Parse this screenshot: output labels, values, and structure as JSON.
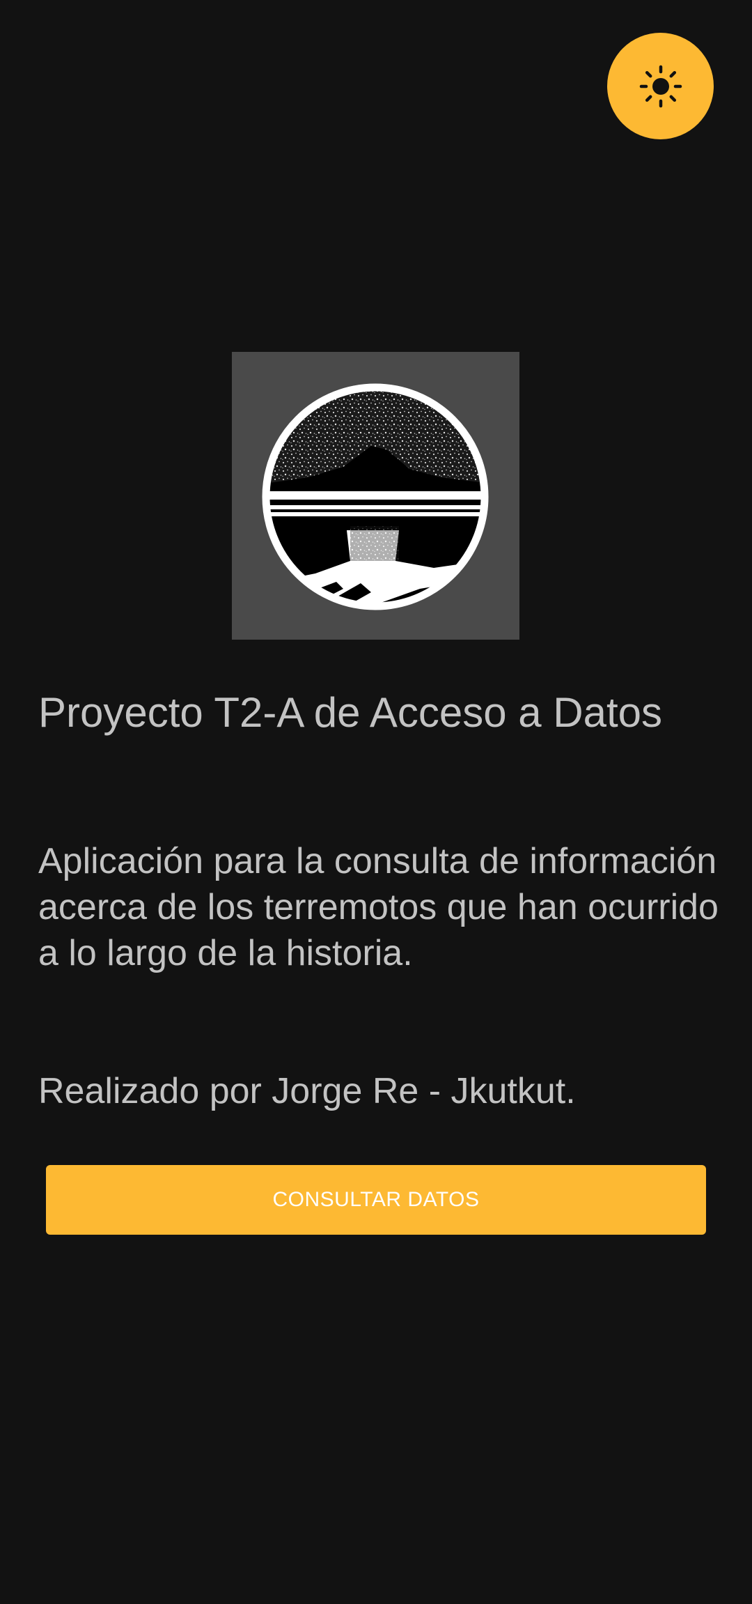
{
  "app": {
    "theme_toggle_icon": "sun-icon",
    "accent_color": "#FDB933",
    "background_color": "#121212",
    "text_color": "#C3C3C3"
  },
  "logo": {
    "icon": "volcano-logo"
  },
  "main": {
    "title": "Proyecto T2-A de Acceso a Datos",
    "description": "Aplicación para la consulta de información acerca de los terremotos que han ocurrido a lo largo de la historia.",
    "author": "Realizado por Jorge Re - Jkutkut.",
    "button_label": "CONSULTAR DATOS"
  }
}
